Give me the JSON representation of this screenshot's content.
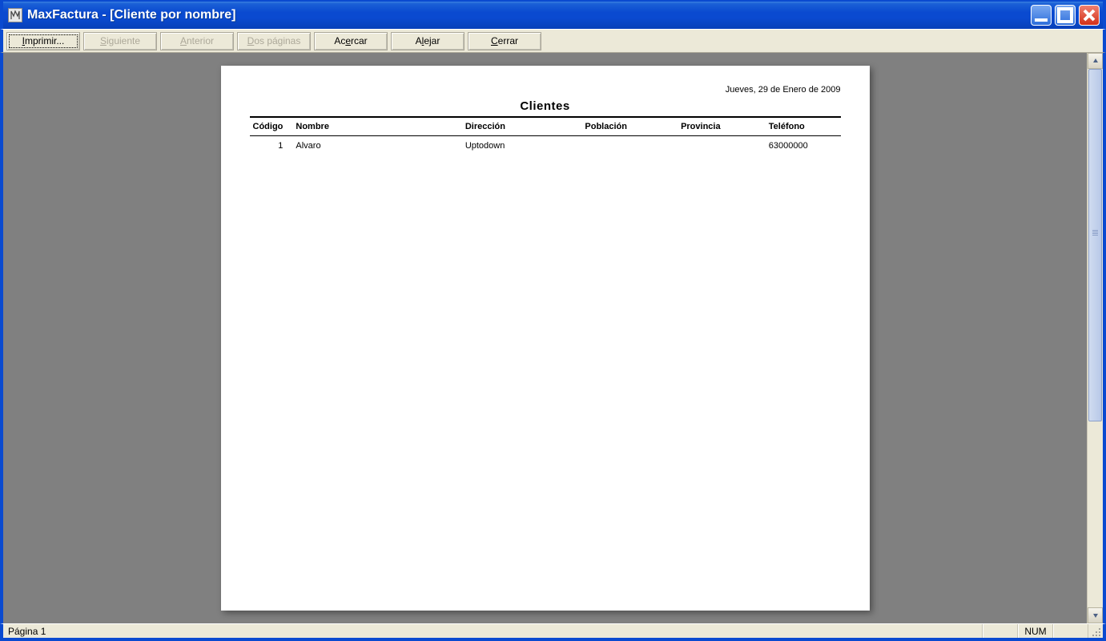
{
  "window": {
    "title": "MaxFactura - [Cliente por nombre]"
  },
  "toolbar": {
    "print": "Imprimir...",
    "next": "Siguiente",
    "prev": "Anterior",
    "twopages": "Dos páginas",
    "zoomin": "Acercar",
    "zoomout": "Alejar",
    "close": "Cerrar"
  },
  "report": {
    "date": "Jueves, 29 de Enero de 2009",
    "title": "Clientes",
    "headers": {
      "codigo": "Código",
      "nombre": "Nombre",
      "direccion": "Dirección",
      "poblacion": "Población",
      "provincia": "Provincia",
      "telefono": "Teléfono"
    },
    "rows": [
      {
        "codigo": "1",
        "nombre": "Alvaro",
        "direccion": "Uptodown",
        "poblacion": "",
        "provincia": "",
        "telefono": "63000000"
      }
    ]
  },
  "status": {
    "page": "Página 1",
    "num": "NUM"
  }
}
